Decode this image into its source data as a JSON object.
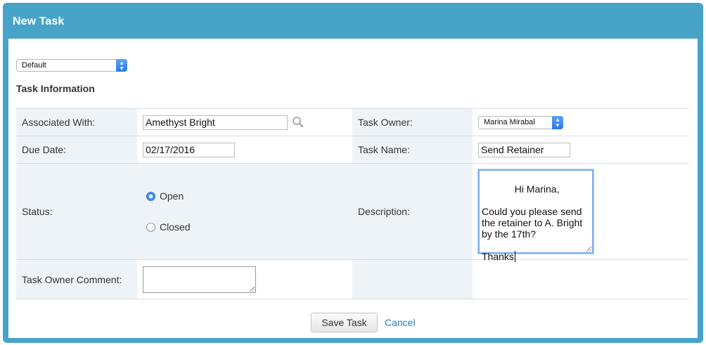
{
  "dialog": {
    "title": "New Task"
  },
  "layout_select": {
    "selected": "Default"
  },
  "section": {
    "title": "Task Information"
  },
  "fields": {
    "associated_with": {
      "label": "Associated With:",
      "value": "Amethyst Bright"
    },
    "task_owner": {
      "label": "Task Owner:",
      "selected": "Marina Mirabal"
    },
    "due_date": {
      "label": "Due Date:",
      "value": "02/17/2016"
    },
    "task_name": {
      "label": "Task Name:",
      "value": "Send Retainer"
    },
    "status": {
      "label": "Status:",
      "options": [
        {
          "label": "Open",
          "checked": true
        },
        {
          "label": "Closed",
          "checked": false
        }
      ]
    },
    "description": {
      "label": "Description:",
      "value": "Hi Marina,\n\nCould you please send the retainer to A. Bright by the 17th?\n\nThanks"
    },
    "task_owner_comment": {
      "label": "Task Owner Comment:",
      "value": ""
    }
  },
  "actions": {
    "save_label": "Save Task",
    "cancel_label": "Cancel"
  },
  "colors": {
    "header_blue": "#48a3c8",
    "label_bg": "#eef3f7",
    "link_blue": "#2a7db8",
    "focus_blue": "#7aaef3"
  },
  "icons": {
    "lookup": "search-icon",
    "select_arrows": "chevron-updown-icon",
    "radio_checked": "radio-checked-icon",
    "radio_unchecked": "radio-unchecked-icon"
  }
}
